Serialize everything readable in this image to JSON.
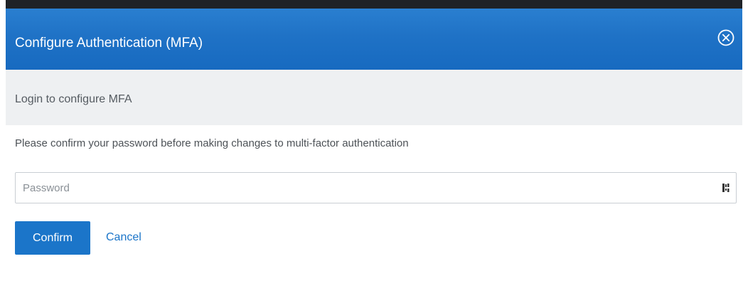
{
  "dialog": {
    "title": "Configure Authentication (MFA)",
    "close_icon": "close-circle-icon"
  },
  "subheader": {
    "text": "Login to configure MFA"
  },
  "content": {
    "instruction": "Please confirm your password before making changes to multi-factor authentication"
  },
  "password": {
    "value": "",
    "placeholder": "Password",
    "manager_icon": "password-manager-icon"
  },
  "actions": {
    "confirm_label": "Confirm",
    "cancel_label": "Cancel"
  },
  "colors": {
    "header_blue": "#1f72c6",
    "button_blue": "#1b75c9",
    "subheader_bg": "#eef0f2"
  }
}
